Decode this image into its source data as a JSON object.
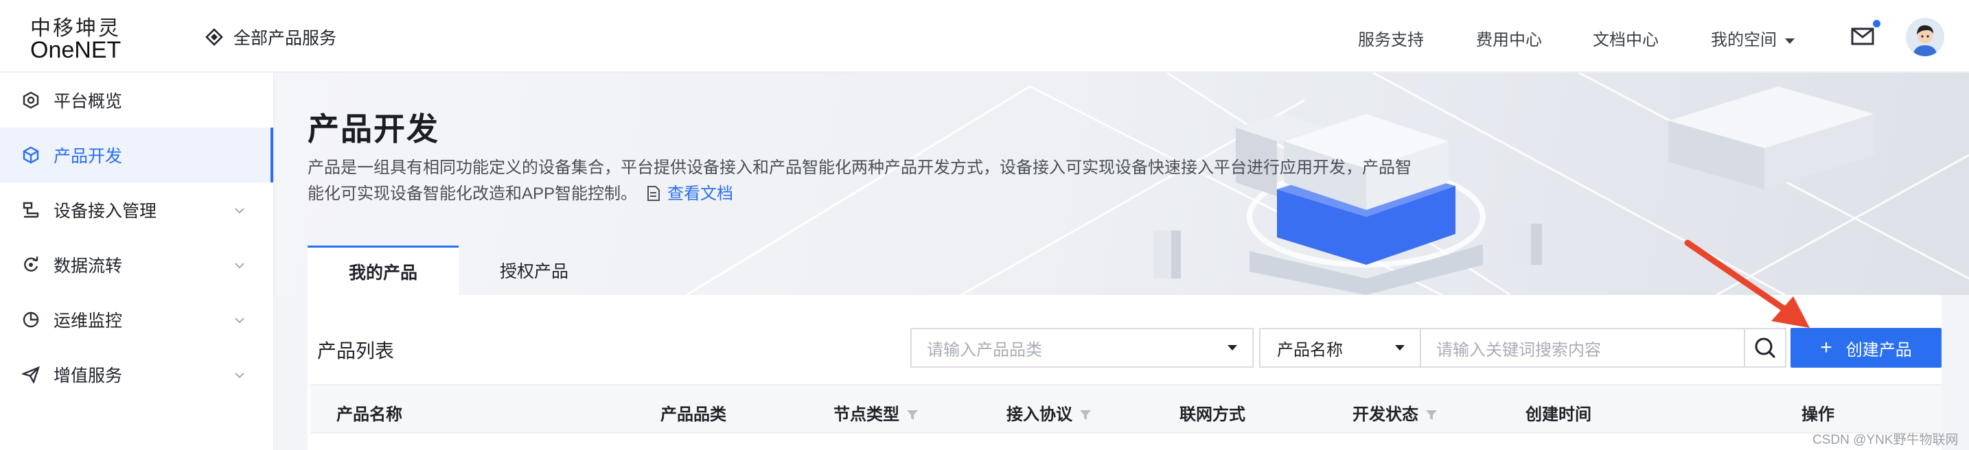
{
  "header": {
    "logo_cn": "中移坤灵",
    "logo_en": "OneNET",
    "all_services": "全部产品服务",
    "nav": [
      {
        "label": "服务支持"
      },
      {
        "label": "费用中心"
      },
      {
        "label": "文档中心"
      },
      {
        "label": "我的空间"
      }
    ]
  },
  "sidebar": {
    "items": [
      {
        "label": "平台概览",
        "icon": "gauge-icon"
      },
      {
        "label": "产品开发",
        "icon": "cube-icon",
        "active": true
      },
      {
        "label": "设备接入管理",
        "icon": "device-icon"
      },
      {
        "label": "数据流转",
        "icon": "flow-icon"
      },
      {
        "label": "运维监控",
        "icon": "monitor-icon"
      },
      {
        "label": "增值服务",
        "icon": "send-icon"
      }
    ]
  },
  "banner": {
    "title": "产品开发",
    "desc_line1": "产品是一组具有相同功能定义的设备集合，平台提供设备接入和产品智能化两种产品开发方式，设备接入可实现设备快速接入平台进行应用开发，产品智",
    "desc_line2": "能化可实现设备智能化改造和APP智能控制。",
    "doc_link": "查看文档"
  },
  "tabs": [
    {
      "label": "我的产品",
      "active": true
    },
    {
      "label": "授权产品"
    }
  ],
  "list": {
    "title": "产品列表",
    "category_placeholder": "请输入产品品类",
    "search_field_selected": "产品名称",
    "keyword_placeholder": "请输入关键词搜索内容",
    "create_label": "创建产品",
    "columns": [
      {
        "label": "产品名称"
      },
      {
        "label": "产品品类"
      },
      {
        "label": "节点类型",
        "filter": true
      },
      {
        "label": "接入协议",
        "filter": true
      },
      {
        "label": "联网方式"
      },
      {
        "label": "开发状态",
        "filter": true
      },
      {
        "label": "创建时间"
      },
      {
        "label": "操作"
      }
    ]
  },
  "watermark": "CSDN @YNK野牛物联网",
  "colors": {
    "accent": "#2a6ff0",
    "arrow": "#e8452c"
  }
}
